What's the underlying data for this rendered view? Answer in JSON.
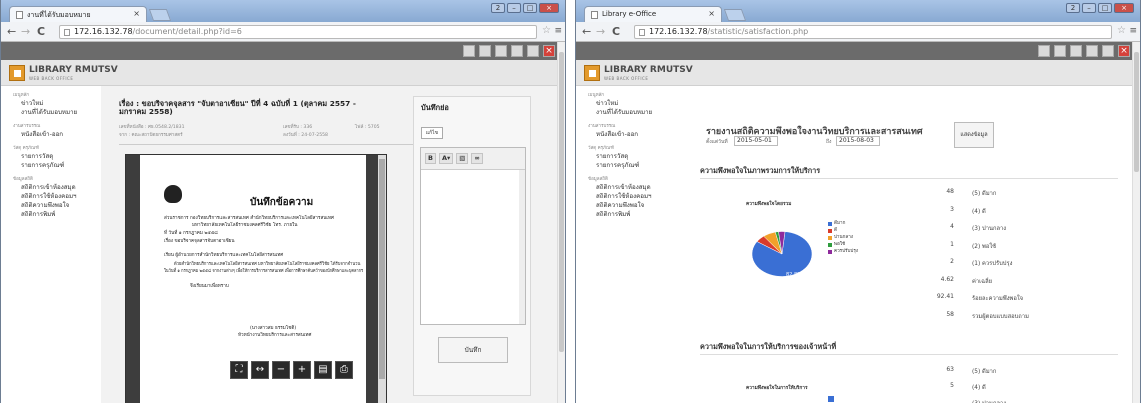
{
  "window_a": {
    "tab_title": "งานที่ได้รับมอบหมาย",
    "url_host": "172.16.132.78",
    "url_path": "/document/detail.php?id=6",
    "logo_title": "LIBRARY RMUTSV",
    "logo_subtitle": "WEB BACK OFFICE",
    "sidebar": [
      {
        "head": "เมนูหลัก",
        "items": [
          "ข่าวใหม่",
          "งานที่ได้รับมอบหมาย"
        ]
      },
      {
        "head": "งานสารบรรณ",
        "items": [
          "หนังสือเข้า-ออก"
        ]
      },
      {
        "head": "วัสดุ ครุภัณฑ์",
        "items": [
          "รายการวัสดุ",
          "รายการครุภัณฑ์"
        ]
      },
      {
        "head": "ข้อมูลสถิติ",
        "items": [
          "สถิติการเข้าห้องสมุด",
          "สถิติการใช้ห้องคอมฯ",
          "สถิติความพึงพอใจ",
          "สถิติการพิมพ์"
        ]
      }
    ],
    "doc_title": "เรื่อง : ขอบริจาคจุลสาร \"จับตาอาเซียน\" ปีที่ 4 ฉบับที่ 1 (ตุลาคม 2557 - มกราคม 2558)",
    "meta": {
      "received": "เลขที่หนังสือ : ศธ.0548.2/1831",
      "from": "จาก : คณะสถาปัตยกรรมศาสตร์",
      "number": "เลขที่รับ : 336",
      "date": "ลงวันที่ : 24-07-2558",
      "file": "ไฟล์ : 5705"
    },
    "memo": {
      "title": "บันทึกข้อความ",
      "line1": "ส่วนราชการ  กองวิทยบริการและสารสนเทศ สำนักวิทยบริการและเทคโนโลยีสารสนเทศ",
      "line2": "มหาวิทยาลัยเทคโนโลยีราชมงคลศรีวิชัย โทร. ภายใน",
      "line3": "ที่                                                 วันที่  ๑  กรกฎาคม  ๒๕๕๘",
      "line4": "เรื่อง  ขอบริจาคจุลสารจับตาอาเซียน",
      "line5": "เรียน  ผู้อำนวยการสำนักวิทยบริการและเทคโนโลยีสารสนเทศ",
      "line6": "ด้วยสำนักวิทยบริการและเทคโนโลยีสารสนเทศ มหาวิทยาลัยเทคโนโลยีราชมงคลศรีวิชัย ได้รับจากจำนวน",
      "line7": "ในวันที่ ๑ กรกฎาคม ๒๕๕๘ จากงานต่างๆ เพื่อให้การบริการสารสนเทศ เพื่อการศึกษาค้นคว้าของนักศึกษาและบุคลากร",
      "line8": "จึงเรียนมาเพื่อทราบ",
      "line9": "(นางสาวสม ธรรมโชติ)",
      "line10": "หัวหน้างานวิทยบริการและสารสนเทศ"
    },
    "note_heading": "บันทึกย่อ",
    "note_edit": "แก้ไข",
    "save_label": "บันทึก"
  },
  "window_b": {
    "tab_title": "Library e-Office",
    "url_host": "172.16.132.78",
    "url_path": "/statistic/satisfaction.php",
    "logo_title": "LIBRARY RMUTSV",
    "logo_subtitle": "WEB BACK OFFICE",
    "sidebar": [
      {
        "head": "เมนูหลัก",
        "items": [
          "ข่าวใหม่",
          "งานที่ได้รับมอบหมาย"
        ]
      },
      {
        "head": "งานสารบรรณ",
        "items": [
          "หนังสือเข้า-ออก"
        ]
      },
      {
        "head": "วัสดุ ครุภัณฑ์",
        "items": [
          "รายการวัสดุ",
          "รายการครุภัณฑ์"
        ]
      },
      {
        "head": "ข้อมูลสถิติ",
        "items": [
          "สถิติการเข้าห้องสมุด",
          "สถิติการใช้ห้องคอมฯ",
          "สถิติความพึงพอใจ",
          "สถิติการพิมพ์"
        ]
      }
    ],
    "report_title": "รายงานสถิติความพึงพอใจงานวิทยบริการและสารสนเทศ",
    "from_label": "ตั้งแต่วันที่",
    "from_value": "2015-05-01",
    "to_label": "ถึง",
    "to_value": "2015-08-03",
    "show_button": "แสดงข้อมูล",
    "section1_title": "ความพึงพอใจในภาพรวมการให้บริการ",
    "section2_title": "ความพึงพอใจในการให้บริการของเจ้าหน้าที่",
    "chart1_label": "ความพึงพอใจโดยรวม",
    "chart2_label": "ความพึงพอใจในการให้บริการ",
    "stats1": [
      {
        "value": "48",
        "label": "(5) ดีมาก"
      },
      {
        "value": "3",
        "label": "(4) ดี"
      },
      {
        "value": "4",
        "label": "(3) ปานกลาง"
      },
      {
        "value": "1",
        "label": "(2) พอใช้"
      },
      {
        "value": "2",
        "label": "(1) ควรปรับปรุง"
      },
      {
        "value": "4.62",
        "label": "ค่าเฉลี่ย"
      },
      {
        "value": "92.41",
        "label": "ร้อยละความพึงพอใจ"
      },
      {
        "value": "58",
        "label": "รวมผู้ตอบแบบสอบถาม"
      }
    ],
    "stats2": [
      {
        "value": "63",
        "label": "(5) ดีมาก"
      },
      {
        "value": "5",
        "label": "(4) ดี"
      },
      {
        "value": "",
        "label": "(3) ปานกลาง"
      }
    ]
  },
  "chart_data": [
    {
      "type": "pie",
      "title": "ความพึงพอใจโดยรวม",
      "categories": [
        "ดีมาก",
        "ดี",
        "ปานกลาง",
        "พอใช้",
        "ควรปรับปรุง"
      ],
      "values": [
        48,
        3,
        4,
        1,
        2
      ],
      "colors": [
        "#3a6fd4",
        "#d93b2b",
        "#f2a12a",
        "#2f9d3e",
        "#8e2a9c"
      ],
      "labels": [
        "82.8%"
      ],
      "legend_position": "right"
    }
  ],
  "colors": {
    "titlebar": "#99b6dd",
    "toolstrip": "#6b6b6b",
    "logo_accent": "#e39a2c",
    "close_red": "#d4413a"
  }
}
